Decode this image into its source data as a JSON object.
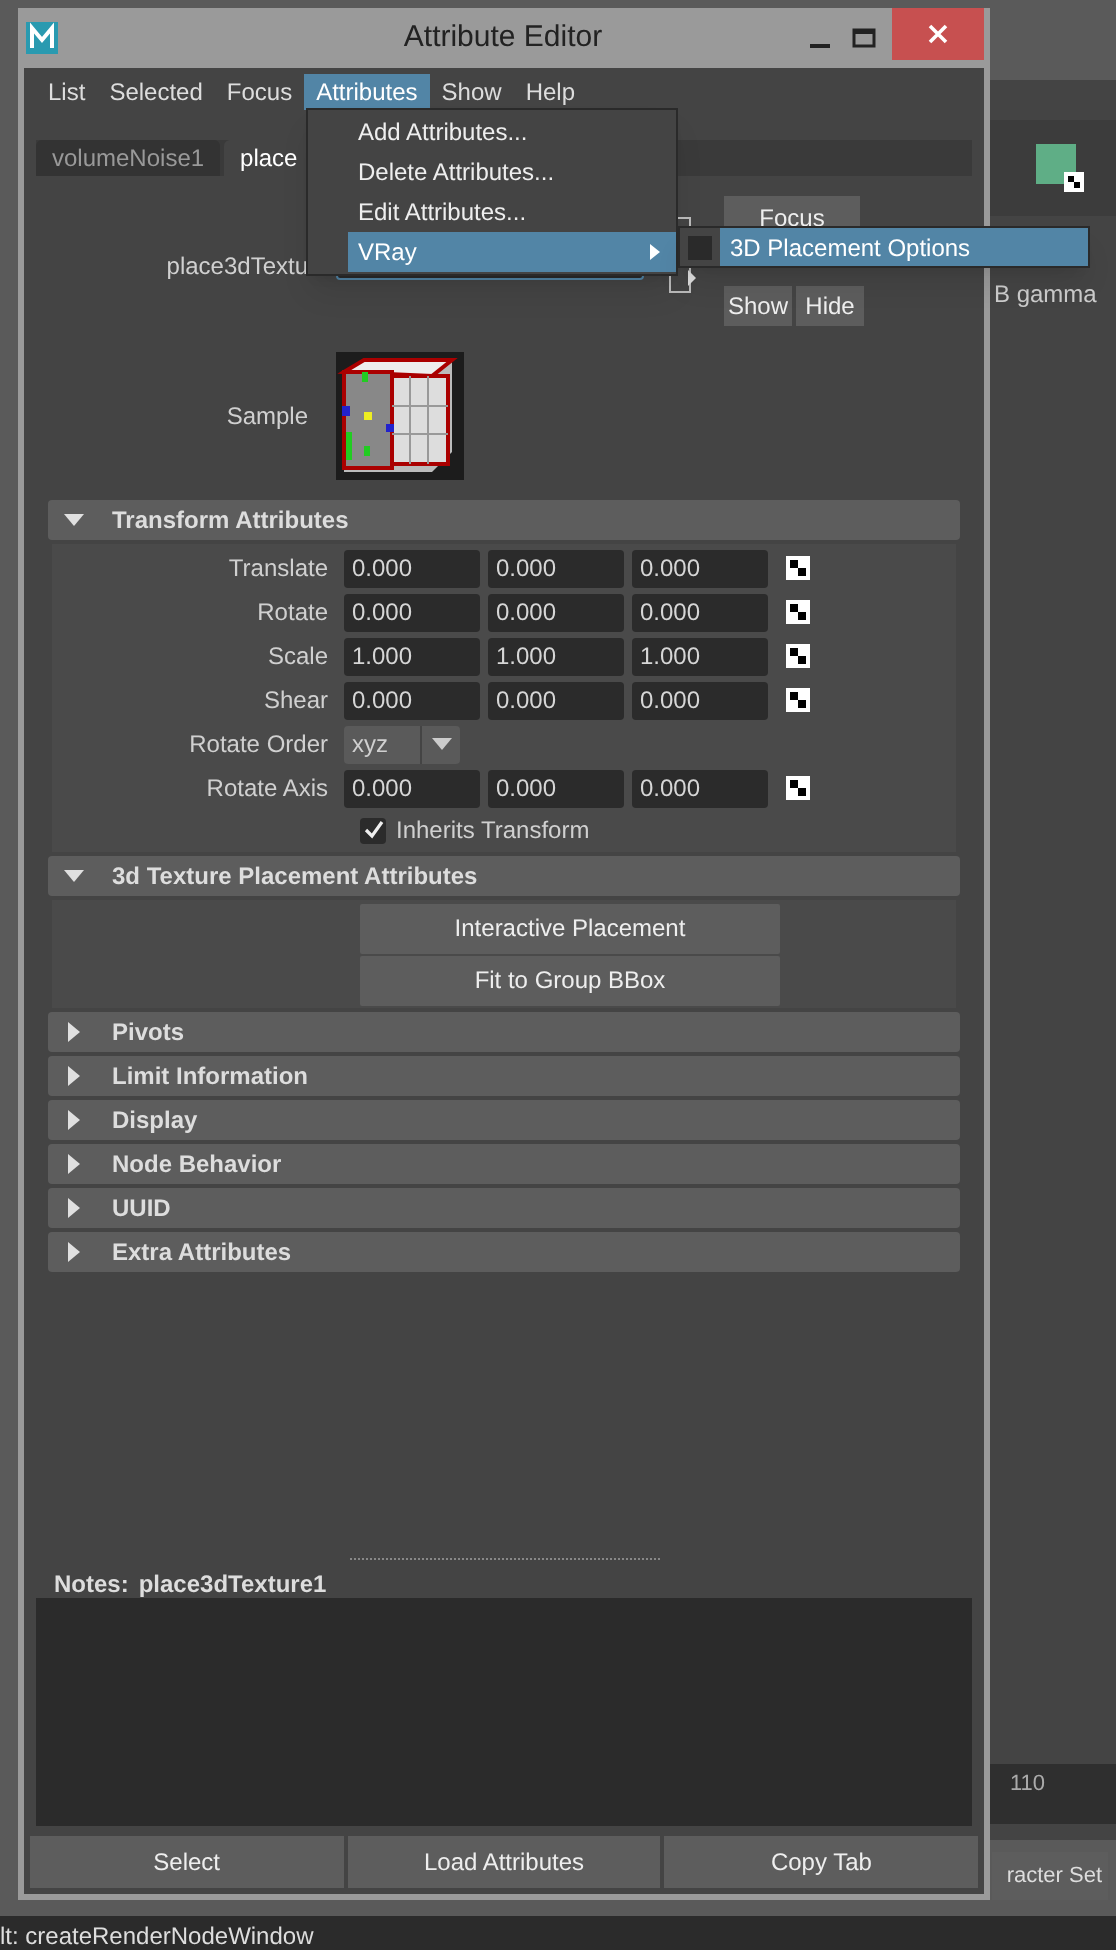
{
  "window": {
    "title": "Attribute Editor"
  },
  "menu_bar": [
    {
      "label": "List",
      "selected": false
    },
    {
      "label": "Selected",
      "selected": false
    },
    {
      "label": "Focus",
      "selected": false
    },
    {
      "label": "Attributes",
      "selected": true
    },
    {
      "label": "Show",
      "selected": false
    },
    {
      "label": "Help",
      "selected": false
    }
  ],
  "open_menu": [
    {
      "label": "Add Attributes...",
      "highlighted": false,
      "submenu": false
    },
    {
      "label": "Delete Attributes...",
      "highlighted": false,
      "submenu": false
    },
    {
      "label": "Edit Attributes...",
      "highlighted": false,
      "submenu": false
    },
    {
      "label": "VRay",
      "highlighted": true,
      "submenu": true
    }
  ],
  "submenu": [
    {
      "label": "3D Placement Options",
      "highlighted": true
    }
  ],
  "node_tabs": [
    {
      "label": "volumeNoise1",
      "selected": false
    },
    {
      "label": "place",
      "selected": true
    }
  ],
  "node_row": {
    "label": "place3dTextu",
    "focus_button": "Focus",
    "show_button": "Show",
    "hide_button": "Hide"
  },
  "sample": {
    "label": "Sample"
  },
  "sections": [
    {
      "title": "Transform Attributes",
      "expanded": true,
      "rows": [
        {
          "kind": "vector",
          "label": "Translate",
          "values": [
            "0.000",
            "0.000",
            "0.000"
          ]
        },
        {
          "kind": "vector",
          "label": "Rotate",
          "values": [
            "0.000",
            "0.000",
            "0.000"
          ]
        },
        {
          "kind": "vector",
          "label": "Scale",
          "values": [
            "1.000",
            "1.000",
            "1.000"
          ]
        },
        {
          "kind": "vector",
          "label": "Shear",
          "values": [
            "0.000",
            "0.000",
            "0.000"
          ]
        },
        {
          "kind": "dropdown",
          "label": "Rotate Order",
          "value": "xyz"
        },
        {
          "kind": "vector",
          "label": "Rotate Axis",
          "values": [
            "0.000",
            "0.000",
            "0.000"
          ]
        },
        {
          "kind": "checkbox",
          "label": "Inherits Transform",
          "checked": true
        }
      ]
    },
    {
      "title": "3d Texture Placement Attributes",
      "expanded": true,
      "rows": [
        {
          "kind": "button",
          "label": "Interactive Placement"
        },
        {
          "kind": "button",
          "label": "Fit to Group BBox"
        }
      ]
    },
    {
      "title": "Pivots",
      "expanded": false
    },
    {
      "title": "Limit Information",
      "expanded": false
    },
    {
      "title": "Display",
      "expanded": false
    },
    {
      "title": "Node Behavior",
      "expanded": false
    },
    {
      "title": "UUID",
      "expanded": false
    },
    {
      "title": "Extra Attributes",
      "expanded": false
    }
  ],
  "notes": {
    "label": "Notes:",
    "node": "place3dTexture1"
  },
  "bottom_buttons": [
    "Select",
    "Load Attributes",
    "Copy Tab"
  ],
  "background": {
    "right_label": "B gamma",
    "ruler_tick": "110",
    "right_button": "racter Set",
    "status_line": "lt: createRenderNodeWindow"
  }
}
